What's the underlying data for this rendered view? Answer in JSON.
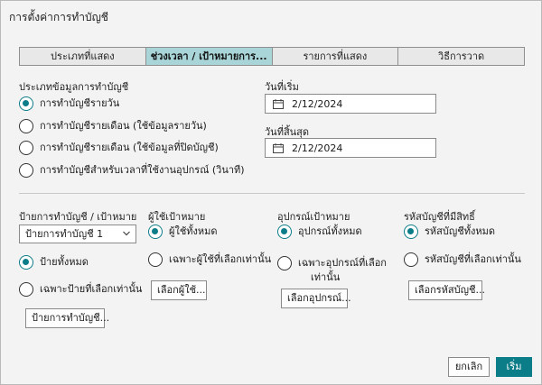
{
  "window": {
    "title": "การตั้งค่าการทำบัญชี"
  },
  "tabs": [
    {
      "label": "ประเภทที่แสดง",
      "active": false
    },
    {
      "label": "ช่วงเวลา / เป้าหมายการ...",
      "active": true
    },
    {
      "label": "รายการที่แสดง",
      "active": false
    },
    {
      "label": "วิธีการวาด",
      "active": false
    }
  ],
  "accounting_type": {
    "label": "ประเภทข้อมูลการทำบัญชี",
    "options": [
      {
        "label": "การทำบัญชีรายวัน",
        "checked": true
      },
      {
        "label": "การทำบัญชีรายเดือน (ใช้ข้อมูลรายวัน)",
        "checked": false
      },
      {
        "label": "การทำบัญชีรายเดือน (ใช้ข้อมูลที่ปิดบัญชี)",
        "checked": false
      },
      {
        "label": "การทำบัญชีสำหรับเวลาที่ใช้งานอุปกรณ์ (วินาที)",
        "checked": false
      }
    ]
  },
  "start_date": {
    "label": "วันที่เริ่ม",
    "value": "2/12/2024"
  },
  "end_date": {
    "label": "วันที่สิ้นสุด",
    "value": "2/12/2024"
  },
  "accounting_tag": {
    "label": "ป้ายการทำบัญชี / เป้าหมาย",
    "select_value": "ป้ายการทำบัญชี 1",
    "options": [
      {
        "label": "ป้ายทั้งหมด",
        "checked": true
      },
      {
        "label": "เฉพาะป้ายที่เลือกเท่านั้น",
        "checked": false
      }
    ],
    "button": "ป้ายการทำบัญชี..."
  },
  "target_users": {
    "label": "ผู้ใช้เป้าหมาย",
    "options": [
      {
        "label": "ผู้ใช้ทั้งหมด",
        "checked": true
      },
      {
        "label": "เฉพาะผู้ใช้ที่เลือกเท่านั้น",
        "checked": false
      }
    ],
    "button": "เลือกผู้ใช้..."
  },
  "target_devices": {
    "label": "อุปกรณ์เป้าหมาย",
    "options": [
      {
        "label": "อุปกรณ์ทั้งหมด",
        "checked": true
      },
      {
        "label_line1": "เฉพาะอุปกรณ์ที่เลือก",
        "label_line2": "เท่านั้น",
        "checked": false
      }
    ],
    "button": "เลือกอุปกรณ์..."
  },
  "privileged_codes": {
    "label": "รหัสบัญชีที่มีสิทธิ์",
    "options": [
      {
        "label": "รหัสบัญชีทั้งหมด",
        "checked": true
      },
      {
        "label": "รหัสบัญชีที่เลือกเท่านั้น",
        "checked": false
      }
    ],
    "button": "เลือกรหัสบัญชี..."
  },
  "footer": {
    "cancel": "ยกเลิก",
    "start": "เริ่ม"
  },
  "colors": {
    "accent": "#0b7d88",
    "active_tab": "#a9d5d9"
  }
}
